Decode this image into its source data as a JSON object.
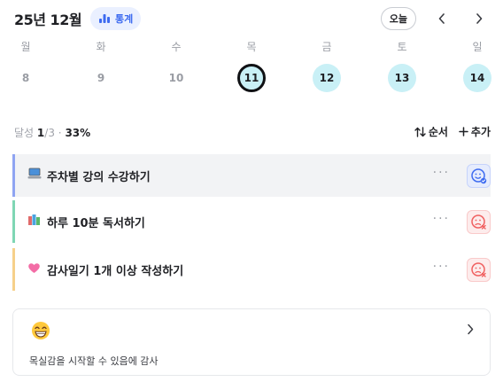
{
  "header": {
    "month": "25년 12월",
    "stats_label": "통계",
    "today_label": "오늘",
    "prev_label": "‹",
    "next_label": "›"
  },
  "week": [
    {
      "dow": "월",
      "day": "8",
      "state": "past"
    },
    {
      "dow": "화",
      "day": "9",
      "state": "past"
    },
    {
      "dow": "수",
      "day": "10",
      "state": "past"
    },
    {
      "dow": "목",
      "day": "11",
      "state": "today"
    },
    {
      "dow": "금",
      "day": "12",
      "state": "future"
    },
    {
      "dow": "토",
      "day": "13",
      "state": "future"
    },
    {
      "dow": "일",
      "day": "14",
      "state": "future"
    }
  ],
  "summary": {
    "label": "달성",
    "done": "1",
    "total": "/3",
    "sep": "·",
    "percent": "33%"
  },
  "actions": {
    "order_label": "순서",
    "add_label": "추가"
  },
  "tasks": [
    {
      "icon": "laptop-icon",
      "title": "주차별 강의 수강하기",
      "more": "···",
      "status": "done",
      "accent": "#8fa4f2"
    },
    {
      "icon": "books-icon",
      "title": "하루 10분 독서하기",
      "more": "···",
      "status": "failed",
      "accent": "#7fd6b4"
    },
    {
      "icon": "pink-heart-icon",
      "title": "감사일기 1개 이상 작성하기",
      "more": "···",
      "status": "failed",
      "accent": "#f6d08a"
    }
  ],
  "gratitude": {
    "icon": "grinning-face-icon",
    "text": "목실감을 시작할 수 있음에 감사"
  },
  "colors": {
    "brand_blue": "#3d6bf0",
    "day_highlight": "#c9f0f6",
    "failed_red": "#f06060",
    "selected_row_bg": "#f2f3f5"
  }
}
